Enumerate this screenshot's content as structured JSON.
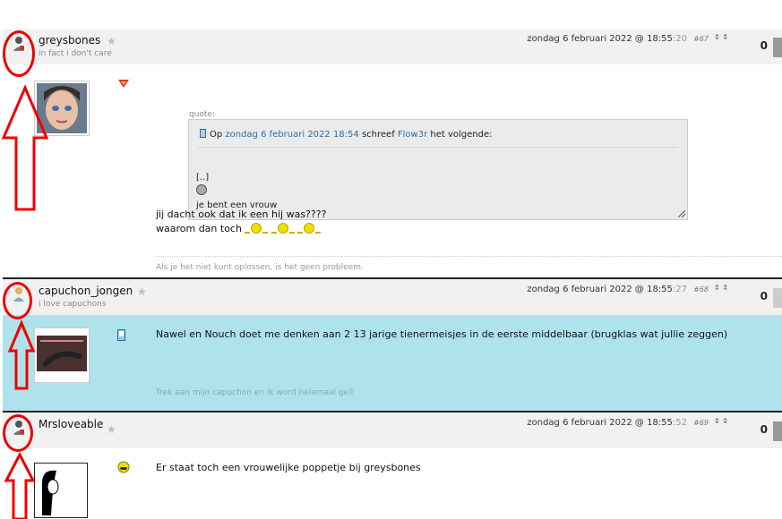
{
  "posts": [
    {
      "username": "greysbones",
      "user_title": "in fact i don't care",
      "date": "zondag 6 februari 2022 @ 18:55",
      "seconds": ":20",
      "post_number": "#67",
      "vote": "⇕ ⇕",
      "score": "0",
      "quote": {
        "label": "quote:",
        "prefix": "Op ",
        "date_link": "zondag 6 februari 2022 18:54",
        "middle": " schreef ",
        "author_link": "Flow3r",
        "suffix": " het volgende:",
        "line1": "[..]",
        "line3": "je bent een vrouw"
      },
      "text_line1": "jij dacht ook dat ik een hij was????",
      "text_line2": "waarom dan toch",
      "signature": "Als je het niet kunt oplossen, is het geen probleem."
    },
    {
      "username": "capuchon_jongen",
      "user_title": "i love capuchons",
      "date": "zondag 6 februari 2022 @ 18:55",
      "seconds": ":27",
      "post_number": "#68",
      "vote": "⇕ ⇕",
      "score": "0",
      "text_line1": "Nawel en Nouch doet me denken aan 2 13 jarige tienermeisjes in de eerste middelbaar (brugklas wat jullie zeggen)",
      "signature": "Trek aan mijn capuchon en ik word helemaal geil"
    },
    {
      "username": "Mrsloveable",
      "date": "zondag 6 februari 2022 @ 18:55",
      "seconds": ":52",
      "post_number": "#69",
      "vote": "⇕ ⇕",
      "score": "0",
      "text_line1": "Er staat toch een vrouwelijke poppetje bij greysbones"
    }
  ],
  "colors": {
    "header_bg": "#f1f1f1",
    "highlight_bg": "#aee3ec",
    "annotation_red": "#e00000",
    "link_blue": "#2a6fa8"
  }
}
